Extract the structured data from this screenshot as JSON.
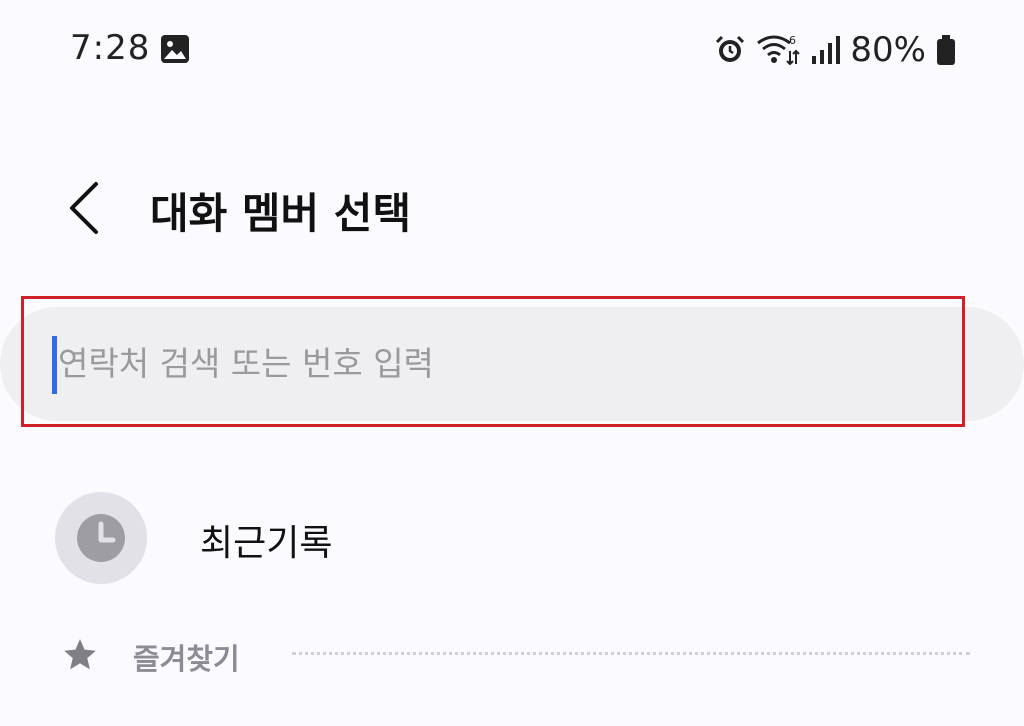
{
  "status_bar": {
    "time": "7:28",
    "icons": [
      "gallery-icon",
      "alarm-icon",
      "wifi-6-icon",
      "signal-icon",
      "battery-icon"
    ],
    "battery_percent": "80%"
  },
  "header": {
    "title": "대화 멤버 선택",
    "back_icon": "chevron-left-icon"
  },
  "search": {
    "placeholder": "연락처 검색 또는 번호 입력",
    "value": ""
  },
  "recent": {
    "label": "최근기록",
    "icon": "clock-icon"
  },
  "favorites": {
    "label": "즐겨찾기",
    "icon": "star-icon"
  },
  "colors": {
    "background": "#fbfafe",
    "search_bg": "#efeff2",
    "caret": "#2f6bea",
    "highlight": "#d2202a"
  }
}
